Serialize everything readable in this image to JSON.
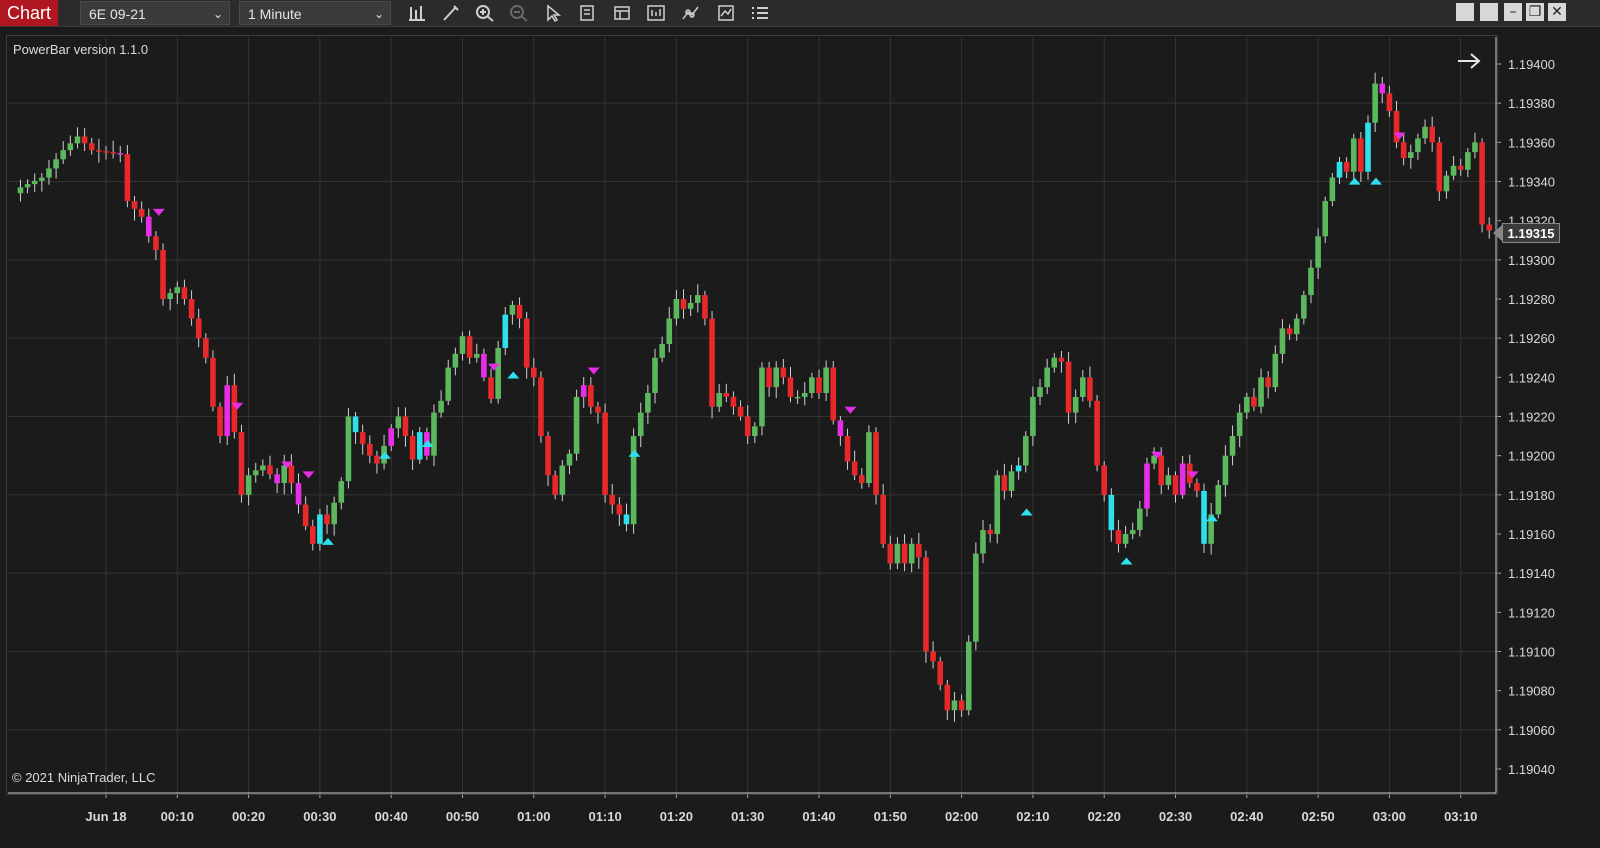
{
  "toolbar": {
    "tab_label": "Chart",
    "instrument": "6E 09-21",
    "interval": "1 Minute",
    "icons": [
      "bar-type-icon",
      "draw-pencil-icon",
      "zoom-in-icon",
      "zoom-out-icon",
      "pointer-icon",
      "properties-icon",
      "templates-icon",
      "data-box-icon",
      "strategies-icon",
      "indicators-icon",
      "list-icon"
    ],
    "window_buttons": [
      "tile-1",
      "tile-2",
      "minimize",
      "restore",
      "close"
    ]
  },
  "chart": {
    "indicator_label": "PowerBar version 1.1.0",
    "copyright": "© 2021 NinjaTrader, LLC",
    "current_price": "1.19315",
    "colors": {
      "up": "#5cb85c",
      "down": "#e8282b",
      "power_down": "#e62ee6",
      "power_up": "#2ee0ee",
      "grid": "#333333",
      "background": "#1b1b1b"
    }
  },
  "chart_data": {
    "type": "candlestick",
    "title": "",
    "instrument": "6E 09-21",
    "interval": "1 Minute",
    "y_ticks": [
      "1.19400",
      "1.19380",
      "1.19360",
      "1.19340",
      "1.19320",
      "1.19300",
      "1.19280",
      "1.19260",
      "1.19240",
      "1.19220",
      "1.19200",
      "1.19180",
      "1.19160",
      "1.19140",
      "1.19120",
      "1.19100",
      "1.19080",
      "1.19060",
      "1.19040"
    ],
    "ylim": [
      1.19033,
      1.19408
    ],
    "x_ticks": [
      "Jun 18",
      "00:10",
      "00:20",
      "00:30",
      "00:40",
      "00:50",
      "01:00",
      "01:10",
      "01:20",
      "01:30",
      "01:40",
      "01:50",
      "02:00",
      "02:10",
      "02:20",
      "02:30",
      "02:40",
      "02:50",
      "03:00",
      "03:10"
    ],
    "x_tick_minutes": [
      0,
      10,
      20,
      30,
      40,
      50,
      60,
      70,
      80,
      90,
      100,
      110,
      120,
      130,
      140,
      150,
      160,
      170,
      180,
      190
    ],
    "x_start_minute": -12,
    "x_end_minute": 197,
    "close_path": [
      [
        -12,
        1.19337
      ],
      [
        -9,
        1.19342
      ],
      [
        -6,
        1.19356
      ],
      [
        -4,
        1.19363
      ],
      [
        -2,
        1.19356
      ],
      [
        2,
        1.19354
      ],
      [
        3,
        1.1933
      ],
      [
        5,
        1.19322
      ],
      [
        6,
        1.19312
      ],
      [
        7,
        1.19305
      ],
      [
        8,
        1.1928
      ],
      [
        10,
        1.19286
      ],
      [
        11,
        1.1928
      ],
      [
        12,
        1.1927
      ],
      [
        13,
        1.1926
      ],
      [
        14,
        1.1925
      ],
      [
        15,
        1.19225
      ],
      [
        16,
        1.1921
      ],
      [
        17,
        1.19236
      ],
      [
        18,
        1.19212
      ],
      [
        19,
        1.1918
      ],
      [
        20,
        1.1919
      ],
      [
        22,
        1.19195
      ],
      [
        24,
        1.19186
      ],
      [
        25,
        1.19195
      ],
      [
        26,
        1.19186
      ],
      [
        27,
        1.19175
      ],
      [
        28,
        1.19164
      ],
      [
        29,
        1.19155
      ],
      [
        30,
        1.1917
      ],
      [
        31,
        1.19165
      ],
      [
        33,
        1.19187
      ],
      [
        34,
        1.1922
      ],
      [
        35,
        1.19212
      ],
      [
        37,
        1.192
      ],
      [
        38,
        1.19196
      ],
      [
        39,
        1.19205
      ],
      [
        40,
        1.19214
      ],
      [
        41,
        1.1922
      ],
      [
        42,
        1.1921
      ],
      [
        43,
        1.19198
      ],
      [
        44,
        1.19212
      ],
      [
        45,
        1.192
      ],
      [
        46,
        1.19222
      ],
      [
        47,
        1.19228
      ],
      [
        48,
        1.19245
      ],
      [
        49,
        1.19252
      ],
      [
        50,
        1.19261
      ],
      [
        51,
        1.1925
      ],
      [
        52,
        1.19252
      ],
      [
        53,
        1.1924
      ],
      [
        54,
        1.19229
      ],
      [
        55,
        1.19255
      ],
      [
        56,
        1.19272
      ],
      [
        57,
        1.19277
      ],
      [
        58,
        1.1927
      ],
      [
        59,
        1.19245
      ],
      [
        60,
        1.1924
      ],
      [
        61,
        1.1921
      ],
      [
        62,
        1.1919
      ],
      [
        63,
        1.1918
      ],
      [
        64,
        1.19195
      ],
      [
        65,
        1.19201
      ],
      [
        66,
        1.1923
      ],
      [
        67,
        1.19236
      ],
      [
        68,
        1.19225
      ],
      [
        69,
        1.19222
      ],
      [
        70,
        1.1918
      ],
      [
        71,
        1.19175
      ],
      [
        72,
        1.1917
      ],
      [
        73,
        1.19165
      ],
      [
        74,
        1.1921
      ],
      [
        75,
        1.19222
      ],
      [
        76,
        1.19232
      ],
      [
        77,
        1.1925
      ],
      [
        78,
        1.19257
      ],
      [
        79,
        1.1927
      ],
      [
        80,
        1.1928
      ],
      [
        81,
        1.19275
      ],
      [
        82,
        1.19278
      ],
      [
        83,
        1.19282
      ],
      [
        84,
        1.1927
      ],
      [
        85,
        1.19225
      ],
      [
        86,
        1.19232
      ],
      [
        87,
        1.1923
      ],
      [
        88,
        1.19225
      ],
      [
        89,
        1.1922
      ],
      [
        90,
        1.1921
      ],
      [
        91,
        1.19215
      ],
      [
        92,
        1.19245
      ],
      [
        93,
        1.19235
      ],
      [
        94,
        1.19245
      ],
      [
        95,
        1.1924
      ],
      [
        96,
        1.1923
      ],
      [
        97,
        1.1923
      ],
      [
        98,
        1.19232
      ],
      [
        99,
        1.1924
      ],
      [
        100,
        1.19232
      ],
      [
        101,
        1.19245
      ],
      [
        102,
        1.19218
      ],
      [
        103,
        1.1921
      ],
      [
        104,
        1.19197
      ],
      [
        105,
        1.1919
      ],
      [
        106,
        1.19186
      ],
      [
        107,
        1.19212
      ],
      [
        108,
        1.1918
      ],
      [
        109,
        1.19155
      ],
      [
        110,
        1.19145
      ],
      [
        111,
        1.19155
      ],
      [
        112,
        1.19145
      ],
      [
        113,
        1.19155
      ],
      [
        114,
        1.19148
      ],
      [
        115,
        1.191
      ],
      [
        116,
        1.19095
      ],
      [
        117,
        1.19083
      ],
      [
        118,
        1.1907
      ],
      [
        119,
        1.19075
      ],
      [
        120,
        1.1907
      ],
      [
        121,
        1.19105
      ],
      [
        122,
        1.1915
      ],
      [
        123,
        1.19162
      ],
      [
        124,
        1.1916
      ],
      [
        125,
        1.1919
      ],
      [
        126,
        1.19182
      ],
      [
        127,
        1.19192
      ],
      [
        128,
        1.19195
      ],
      [
        129,
        1.1921
      ],
      [
        130,
        1.1923
      ],
      [
        131,
        1.19235
      ],
      [
        132,
        1.19245
      ],
      [
        133,
        1.1925
      ],
      [
        134,
        1.19248
      ],
      [
        135,
        1.19222
      ],
      [
        136,
        1.1923
      ],
      [
        137,
        1.1924
      ],
      [
        138,
        1.19228
      ],
      [
        139,
        1.19195
      ],
      [
        140,
        1.1918
      ],
      [
        141,
        1.19162
      ],
      [
        142,
        1.19155
      ],
      [
        143,
        1.1916
      ],
      [
        144,
        1.19162
      ],
      [
        145,
        1.19173
      ],
      [
        146,
        1.19196
      ],
      [
        147,
        1.192
      ],
      [
        148,
        1.19185
      ],
      [
        149,
        1.1919
      ],
      [
        150,
        1.1918
      ],
      [
        151,
        1.19196
      ],
      [
        152,
        1.19186
      ],
      [
        153,
        1.19182
      ],
      [
        154,
        1.19155
      ],
      [
        155,
        1.1917
      ],
      [
        156,
        1.19185
      ],
      [
        157,
        1.192
      ],
      [
        158,
        1.1921
      ],
      [
        159,
        1.19222
      ],
      [
        160,
        1.1923
      ],
      [
        161,
        1.19225
      ],
      [
        162,
        1.1924
      ],
      [
        163,
        1.19235
      ],
      [
        164,
        1.19252
      ],
      [
        165,
        1.19265
      ],
      [
        166,
        1.19262
      ],
      [
        167,
        1.1927
      ],
      [
        168,
        1.19282
      ],
      [
        169,
        1.19296
      ],
      [
        170,
        1.19312
      ],
      [
        171,
        1.1933
      ],
      [
        172,
        1.19342
      ],
      [
        173,
        1.1935
      ],
      [
        174,
        1.19345
      ],
      [
        175,
        1.19362
      ],
      [
        176,
        1.19345
      ],
      [
        177,
        1.1937
      ],
      [
        178,
        1.1939
      ],
      [
        179,
        1.19385
      ],
      [
        180,
        1.19376
      ],
      [
        181,
        1.1936
      ],
      [
        182,
        1.19352
      ],
      [
        183,
        1.19355
      ],
      [
        184,
        1.19362
      ],
      [
        185,
        1.19368
      ],
      [
        186,
        1.1936
      ],
      [
        187,
        1.19335
      ],
      [
        188,
        1.19343
      ],
      [
        189,
        1.19348
      ],
      [
        190,
        1.19346
      ],
      [
        191,
        1.19355
      ],
      [
        192,
        1.1936
      ],
      [
        193,
        1.19318
      ],
      [
        194,
        1.19315
      ]
    ],
    "power_down_minutes": [
      2,
      6,
      17,
      24,
      27,
      40,
      45,
      53,
      67,
      103,
      146,
      151,
      179
    ],
    "power_up_minutes": [
      30,
      35,
      44,
      56,
      73,
      128,
      141,
      154,
      173,
      177
    ],
    "signal_down": [
      [
        6,
        1.19326
      ],
      [
        17,
        1.19227
      ],
      [
        24,
        1.19197
      ],
      [
        27,
        1.19192
      ],
      [
        53,
        1.19247
      ],
      [
        67,
        1.19245
      ],
      [
        103,
        1.19225
      ],
      [
        146,
        1.19202
      ],
      [
        151,
        1.19192
      ],
      [
        180,
        1.19365
      ]
    ],
    "signal_up": [
      [
        30,
        1.19158
      ],
      [
        38,
        1.19202
      ],
      [
        44,
        1.19208
      ],
      [
        56,
        1.19243
      ],
      [
        73,
        1.19203
      ],
      [
        128,
        1.19173
      ],
      [
        142,
        1.19148
      ],
      [
        154,
        1.1917
      ],
      [
        174,
        1.19342
      ],
      [
        177,
        1.19342
      ]
    ]
  }
}
